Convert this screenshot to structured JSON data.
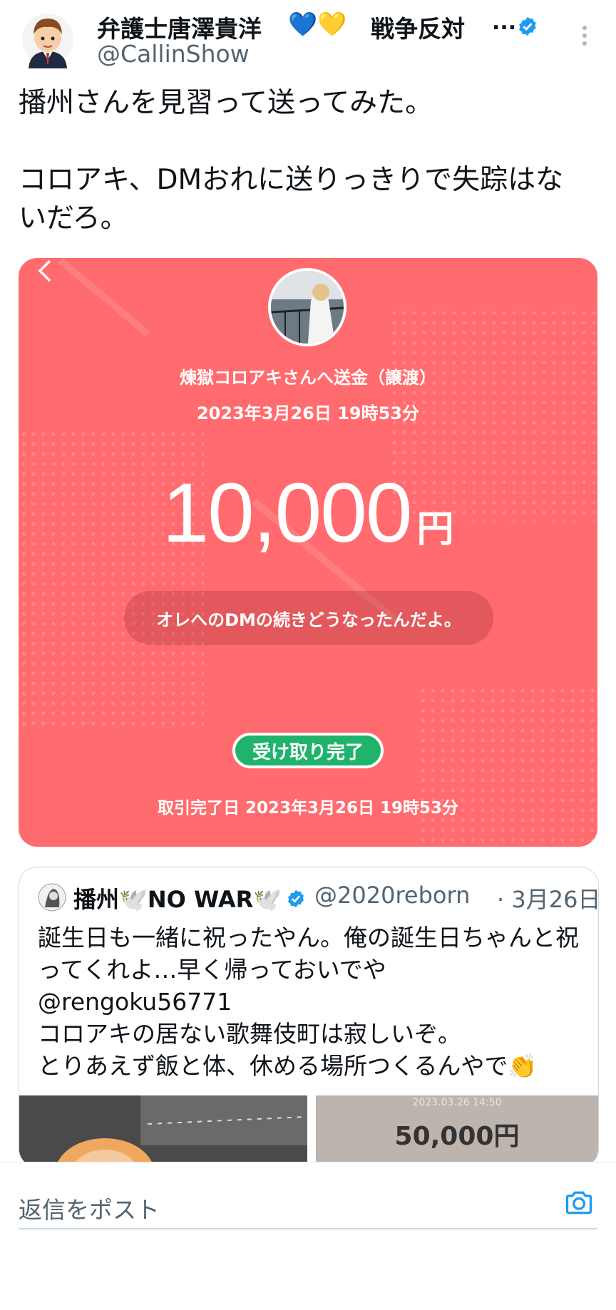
{
  "author": {
    "name": "弁護士唐澤貴洋",
    "hearts": "💙💛",
    "tag": "戦争反対",
    "ellipsis": "...",
    "handle": "@CallinShow"
  },
  "tweet_text": "播州さんを見習って送ってみた。\n\nコロアキ、DMおれに送りっきりで失踪はないだろ。",
  "pay_card": {
    "recipient_text": "煉獄コロアキさんへ送金（譲渡）",
    "send_date": "2023年3月26日 19時53分",
    "amount": "10,000",
    "unit": "円",
    "message": "オレへのDMの続きどうなったんだよ。",
    "status": "受け取り完了",
    "complete_date": "取引完了日 2023年3月26日 19時53分"
  },
  "quote": {
    "name": "播州🕊️NO WAR🕊️",
    "handle": "@2020reborn",
    "date": "· 3月26日",
    "text": "誕生日も一緒に祝ったやん。俺の誕生日ちゃんと祝ってくれよ…早く帰っておいでや\n@rengoku56771\nコロアキの居ない歌舞伎町は寂しいぞ。\nとりあえず飯と体、休める場所つくるんやで👏",
    "image2_stamp": "2023.03.26 14:50",
    "image2_amount": "50,000円"
  },
  "reply": {
    "placeholder": "返信をポスト"
  },
  "colors": {
    "card_bg": "#ff6b6e",
    "badge_green": "#20b36b",
    "verified_blue": "#1d9bf0",
    "muted_text": "#536471"
  },
  "icons": [
    "avatar",
    "verified-badge-icon",
    "more-vert-icon",
    "chevron-left-icon",
    "camera-icon"
  ]
}
